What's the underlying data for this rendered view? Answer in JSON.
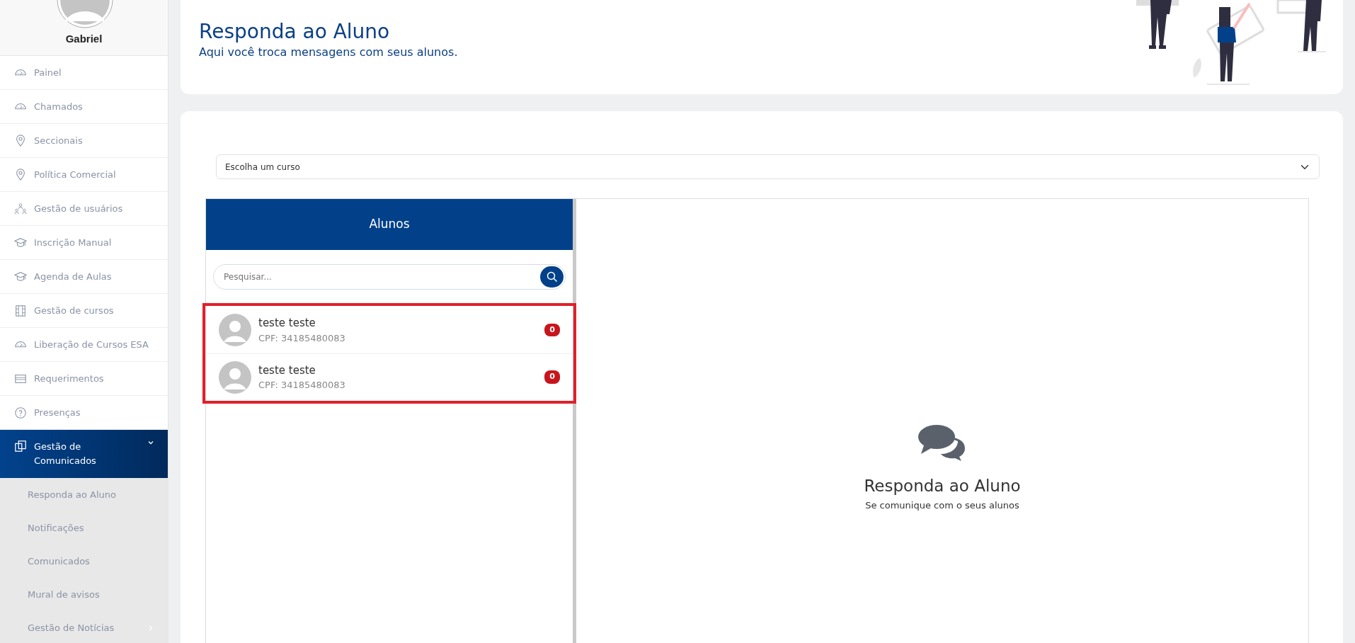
{
  "user": {
    "name": "Gabriel"
  },
  "sidebar": {
    "items": [
      {
        "label": "Painel",
        "kind": "gauge",
        "expanded": false,
        "has_children": false
      },
      {
        "label": "Chamados",
        "kind": "gauge",
        "expanded": false,
        "has_children": false
      },
      {
        "label": "Seccionais",
        "kind": "pin",
        "expanded": false,
        "has_children": false
      },
      {
        "label": "Política Comercial",
        "kind": "pin",
        "expanded": false,
        "has_children": false
      },
      {
        "label": "Gestão de usuários",
        "kind": "users",
        "expanded": false,
        "has_children": false
      },
      {
        "label": "Inscrição Manual",
        "kind": "cap",
        "expanded": false,
        "has_children": false
      },
      {
        "label": "Agenda de Aulas",
        "kind": "cap",
        "expanded": false,
        "has_children": false
      },
      {
        "label": "Gestão de cursos",
        "kind": "film",
        "expanded": false,
        "has_children": false
      },
      {
        "label": "Liberação de Cursos ESA",
        "kind": "gauge",
        "expanded": false,
        "has_children": false
      },
      {
        "label": "Requerimentos",
        "kind": "card",
        "expanded": false,
        "has_children": false
      },
      {
        "label": "Presenças",
        "kind": "question",
        "expanded": false,
        "has_children": false
      },
      {
        "label": "Gestão de Comunicados",
        "kind": "pages",
        "expanded": true,
        "has_children": true,
        "children": [
          {
            "label": "Responda ao Aluno",
            "has_children": false
          },
          {
            "label": "Notificações",
            "has_children": false
          },
          {
            "label": "Comunicados",
            "has_children": false
          },
          {
            "label": "Mural de avisos",
            "has_children": false
          },
          {
            "label": "Gestão de Notícias",
            "has_children": true
          }
        ]
      }
    ]
  },
  "header": {
    "title": "Responda ao Aluno",
    "subtitle": "Aqui você troca mensagens com seus alunos."
  },
  "course_select": {
    "value": "Escolha um curso"
  },
  "students_panel": {
    "title": "Alunos",
    "search": {
      "placeholder": "Pesquisar..."
    },
    "highlighted": true,
    "items": [
      {
        "name": "teste teste",
        "cpf": "CPF: 34185480083",
        "unread": "0"
      },
      {
        "name": "teste teste",
        "cpf": "CPF: 34185480083",
        "unread": "0"
      }
    ]
  },
  "empty_state": {
    "title": "Responda ao Aluno",
    "subtitle": "Se comunique com o seus alunos"
  }
}
